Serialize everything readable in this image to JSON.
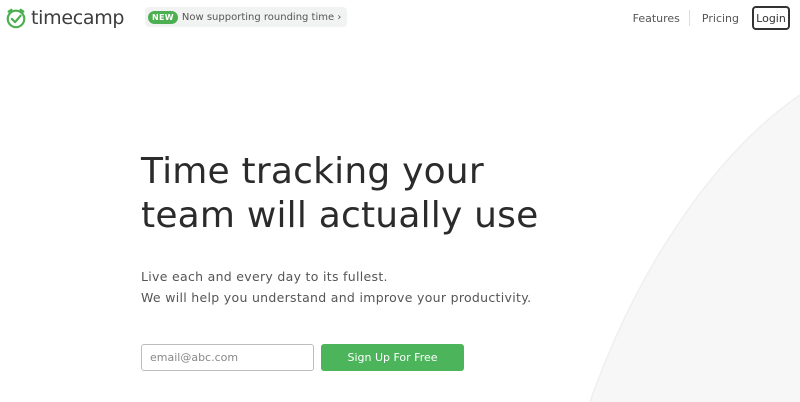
{
  "header": {
    "logo_text": "timecamp",
    "announcement": {
      "badge": "NEW",
      "text": "Now supporting rounding time ›"
    },
    "nav": {
      "features": "Features",
      "pricing": "Pricing",
      "login": "Login"
    }
  },
  "hero": {
    "title_line1": "Time tracking your",
    "title_line2": "team will actually use",
    "subtitle_line1": "Live each and every day to its fullest.",
    "subtitle_line2": "We will help you understand and improve your productivity."
  },
  "signup": {
    "email_placeholder": "email@abc.com",
    "email_value": "",
    "button_label": "Sign Up For Free"
  },
  "colors": {
    "brand_green": "#4cb55b",
    "text_dark": "#2b2b2b"
  },
  "icons": {
    "logo": "timecamp-clock-check-icon"
  }
}
